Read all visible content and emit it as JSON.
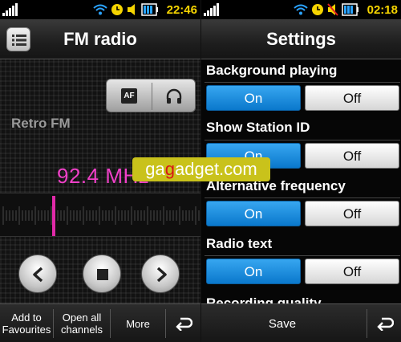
{
  "left_screen": {
    "status_time": "22:46",
    "title": "FM radio",
    "af_label": "AF",
    "station_name": "Retro FM",
    "frequency": "92.4 MHz",
    "bottom_bar": {
      "add_favourites": "Add to\nFavourites",
      "open_all_channels": "Open all\nchannels",
      "more": "More"
    }
  },
  "right_screen": {
    "status_time": "02:18",
    "title": "Settings",
    "settings": [
      {
        "label": "Background playing",
        "on": "On",
        "off": "Off",
        "selected": "On"
      },
      {
        "label": "Show Station ID",
        "on": "On",
        "off": "Off",
        "selected": "On"
      },
      {
        "label": "Alternative frequency",
        "on": "On",
        "off": "Off",
        "selected": "On"
      },
      {
        "label": "Radio text",
        "on": "On",
        "off": "Off",
        "selected": "On"
      }
    ],
    "partial_setting_label": "Recording quality",
    "save_label": "Save"
  },
  "watermark": {
    "prefix": "ga",
    "accent": "g",
    "rest": "adget.com"
  },
  "colors": {
    "accent_blue": "#1a8ee0",
    "frequency_pink": "#f040c8",
    "clock_yellow": "#f5d400",
    "watermark_yellow": "#c9c21b"
  },
  "tuner_position": 0.27
}
